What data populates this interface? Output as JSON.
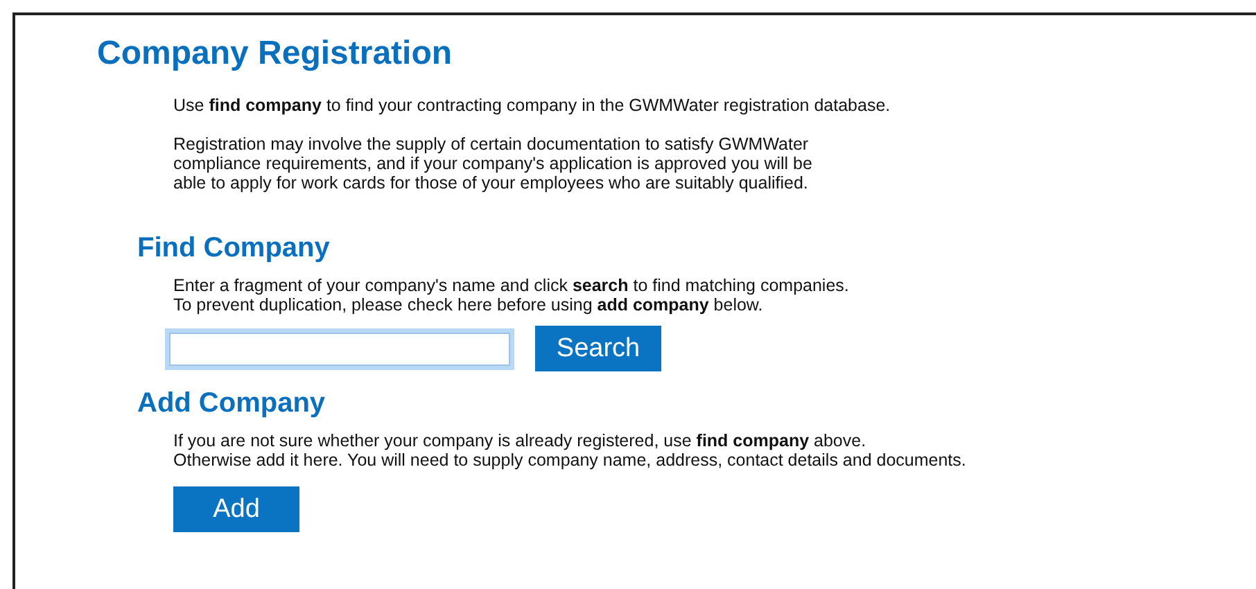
{
  "title": "Company Registration",
  "intro": [
    "Use **find company** to find your contracting company in the GWMWater registration database.",
    "Registration may involve the supply of certain documentation to satisfy GWMWater\ncompliance requirements, and if your company's application is approved you will be\nable to apply for work cards for those of your employees who are suitably qualified."
  ],
  "find_company": {
    "heading": "Find Company",
    "text": "Enter a fragment of your company's name and click **search** to find matching companies.\nTo prevent duplication, please check here before using **add company** below.",
    "search_field": {
      "focused": true
    },
    "button": "Search"
  },
  "add_company": {
    "heading": "Add Company",
    "text": "If you are not sure whether your company is already registered, use **find company** above.\nOtherwise add it here. You will need to supply company name, address, contact details and documents.",
    "button": "Add"
  }
}
